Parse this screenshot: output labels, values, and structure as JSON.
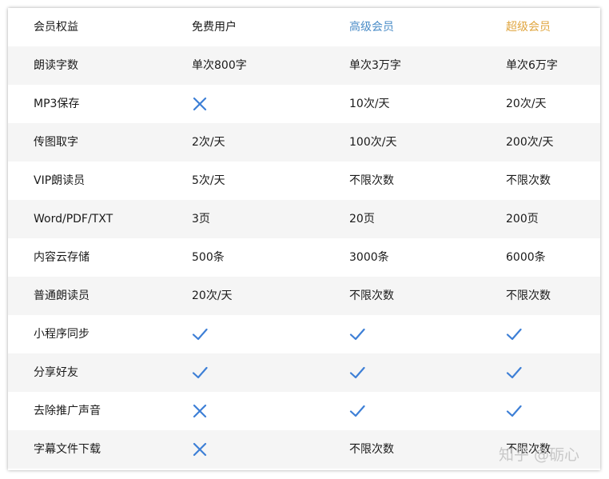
{
  "header": {
    "col0": "会员权益",
    "col1": "免费用户",
    "col2": "高级会员",
    "col3": "超级会员"
  },
  "colors": {
    "premium": "#4a8cc7",
    "super": "#e0a640",
    "icon": "#3d7fd6",
    "alt_row": "#f5f5f5"
  },
  "rows": [
    {
      "feature": "朗读字数",
      "free": "单次800字",
      "premium": "单次3万字",
      "super": "单次6万字"
    },
    {
      "feature": "MP3保存",
      "free": "cross-icon",
      "premium": "10次/天",
      "super": "20次/天"
    },
    {
      "feature": "传图取字",
      "free": "2次/天",
      "premium": "100次/天",
      "super": "200次/天"
    },
    {
      "feature": "VIP朗读员",
      "free": "5次/天",
      "premium": "不限次数",
      "super": "不限次数"
    },
    {
      "feature": "Word/PDF/TXT",
      "free": "3页",
      "premium": "20页",
      "super": "200页"
    },
    {
      "feature": "内容云存储",
      "free": "500条",
      "premium": "3000条",
      "super": "6000条"
    },
    {
      "feature": "普通朗读员",
      "free": "20次/天",
      "premium": "不限次数",
      "super": "不限次数"
    },
    {
      "feature": "小程序同步",
      "free": "check-icon",
      "premium": "check-icon",
      "super": "check-icon"
    },
    {
      "feature": "分享好友",
      "free": "check-icon",
      "premium": "check-icon",
      "super": "check-icon"
    },
    {
      "feature": "去除推广声音",
      "free": "cross-icon",
      "premium": "check-icon",
      "super": "check-icon"
    },
    {
      "feature": "字幕文件下载",
      "free": "cross-icon",
      "premium": "不限次数",
      "super": "不限次数"
    }
  ],
  "watermark": "知乎 @砺心"
}
